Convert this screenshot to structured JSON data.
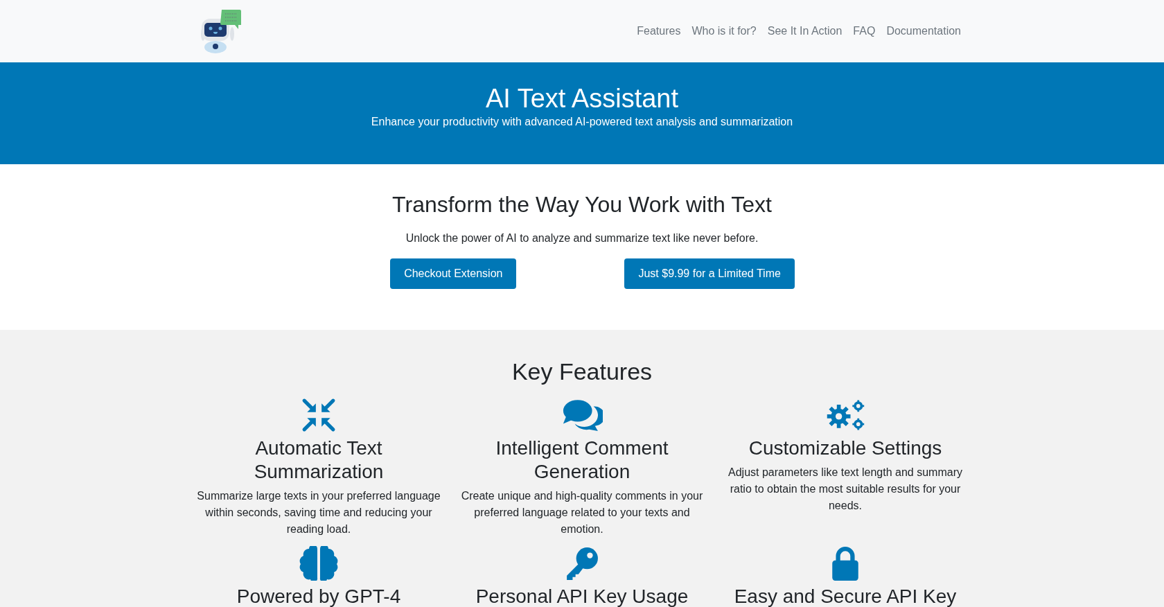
{
  "nav": {
    "links": [
      {
        "label": "Features"
      },
      {
        "label": "Who is it for?"
      },
      {
        "label": "See It In Action"
      },
      {
        "label": "FAQ"
      },
      {
        "label": "Documentation"
      }
    ]
  },
  "hero": {
    "title": "AI Text Assistant",
    "subtitle": "Enhance your productivity with advanced AI-powered text analysis and summarization"
  },
  "intro": {
    "heading": "Transform the Way You Work with Text",
    "text": "Unlock the power of AI to analyze and summarize text like never before.",
    "buttons": [
      "Checkout Extension",
      "Just $9.99 for a Limited Time"
    ]
  },
  "features": {
    "heading": "Key Features",
    "items": [
      {
        "title": "Automatic Text Summarization",
        "text": "Summarize large texts in your preferred language within seconds, saving time and reducing your reading load."
      },
      {
        "title": "Intelligent Comment Generation",
        "text": "Create unique and high-quality comments in your preferred language related to your texts and emotion."
      },
      {
        "title": "Customizable Settings",
        "text": "Adjust parameters like text length and summary ratio to obtain the most suitable results for your needs."
      },
      {
        "title": "Powered by GPT-4"
      },
      {
        "title": "Personal API Key Usage"
      },
      {
        "title": "Easy and Secure API Key"
      }
    ]
  }
}
